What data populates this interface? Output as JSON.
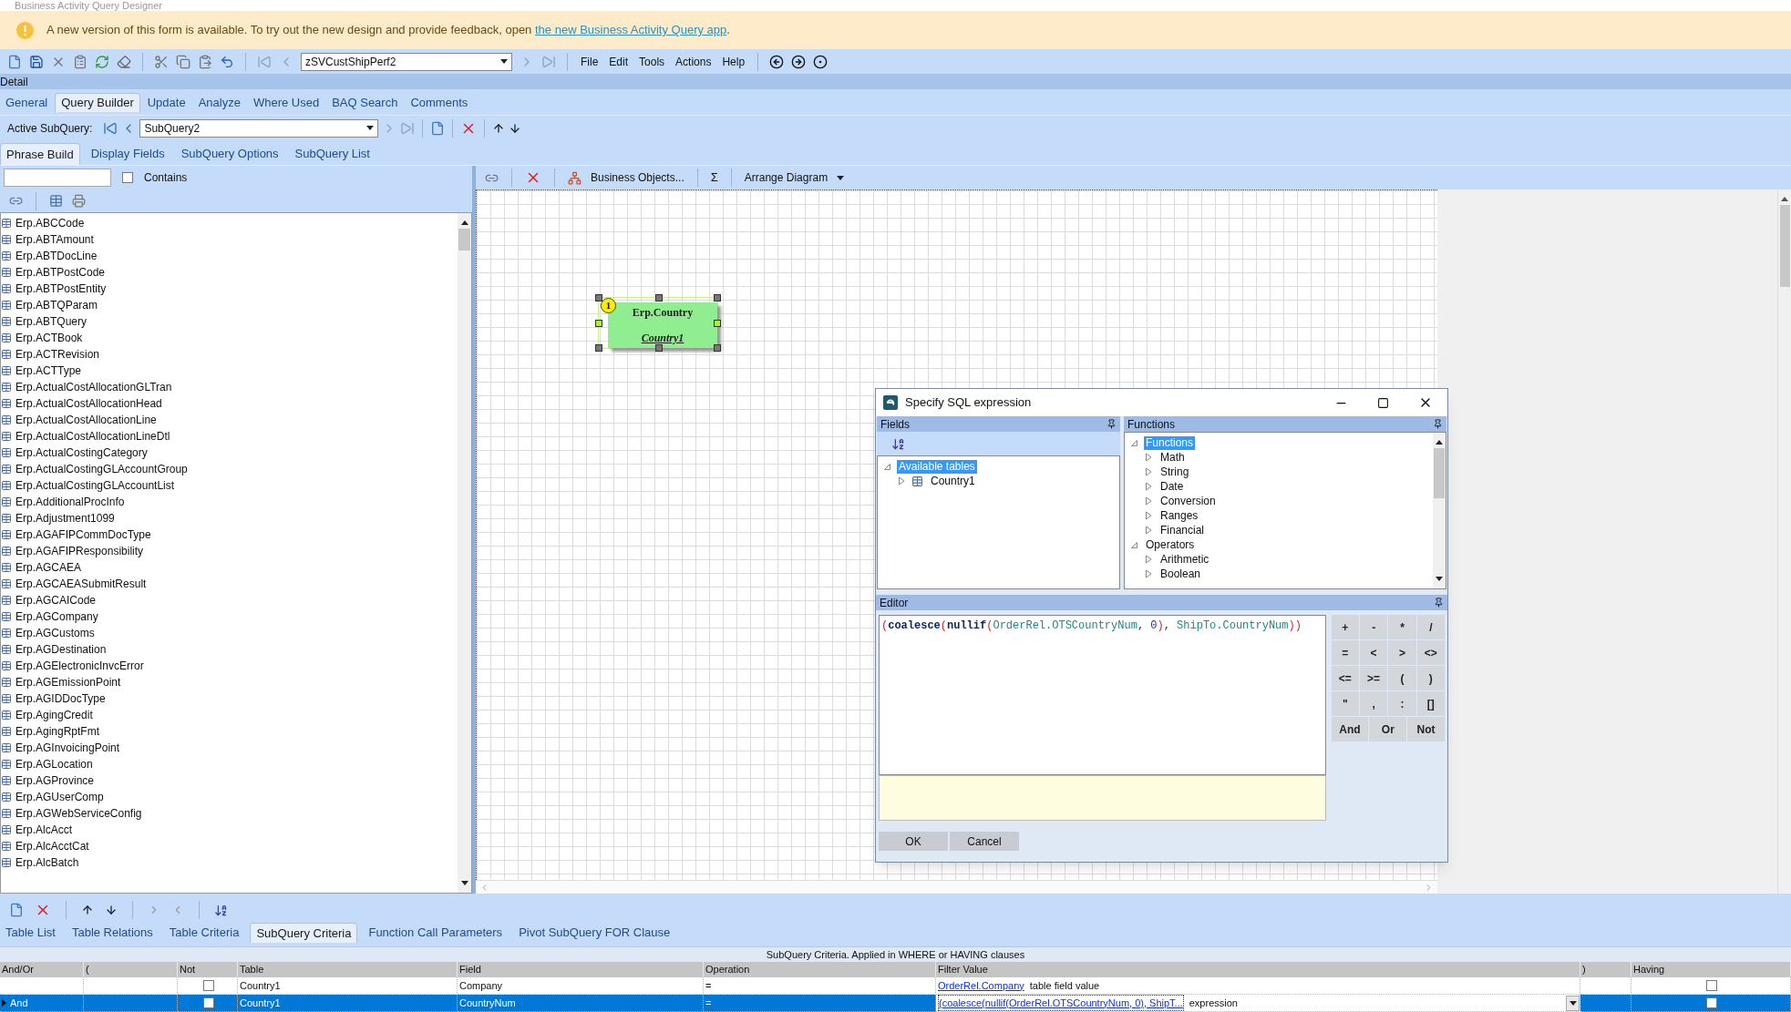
{
  "window": {
    "title": "Business Activity Query Designer"
  },
  "banner": {
    "text": "A new version of this form is available. To try out the new design and provide feedback, open",
    "link": "the new Business Activity Query app",
    "suffix": "."
  },
  "toolbar": {
    "query_id": "zSVCustShipPerf2",
    "menus": [
      "File",
      "Edit",
      "Tools",
      "Actions",
      "Help"
    ]
  },
  "section": "Detail",
  "tabs": [
    {
      "label": "General",
      "selected": false
    },
    {
      "label": "Query Builder",
      "selected": true
    },
    {
      "label": "Update",
      "selected": false
    },
    {
      "label": "Analyze",
      "selected": false
    },
    {
      "label": "Where Used",
      "selected": false
    },
    {
      "label": "BAQ Search",
      "selected": false
    },
    {
      "label": "Comments",
      "selected": false
    }
  ],
  "active_subquery": {
    "label": "Active SubQuery:",
    "value": "SubQuery2"
  },
  "subtabs": [
    {
      "label": "Phrase Build",
      "selected": true
    },
    {
      "label": "Display Fields",
      "selected": false
    },
    {
      "label": "SubQuery Options",
      "selected": false
    },
    {
      "label": "SubQuery List",
      "selected": false
    }
  ],
  "table_search": {
    "contains_label": "Contains",
    "contains_checked": false
  },
  "tables": [
    "Erp.ABCCode",
    "Erp.ABTAmount",
    "Erp.ABTDocLine",
    "Erp.ABTPostCode",
    "Erp.ABTPostEntity",
    "Erp.ABTQParam",
    "Erp.ABTQuery",
    "Erp.ACTBook",
    "Erp.ACTRevision",
    "Erp.ACTType",
    "Erp.ActualCostAllocationGLTran",
    "Erp.ActualCostAllocationHead",
    "Erp.ActualCostAllocationLine",
    "Erp.ActualCostAllocationLineDtl",
    "Erp.ActualCostingCategory",
    "Erp.ActualCostingGLAccountGroup",
    "Erp.ActualCostingGLAccountList",
    "Erp.AdditionalProcInfo",
    "Erp.Adjustment1099",
    "Erp.AGAFIPCommDocType",
    "Erp.AGAFIPResponsibility",
    "Erp.AGCAEA",
    "Erp.AGCAEASubmitResult",
    "Erp.AGCAICode",
    "Erp.AGCompany",
    "Erp.AGCustoms",
    "Erp.AGDestination",
    "Erp.AGElectronicInvcError",
    "Erp.AGEmissionPoint",
    "Erp.AGIDDocType",
    "Erp.AgingCredit",
    "Erp.AgingRptFmt",
    "Erp.AGInvoicingPoint",
    "Erp.AGLocation",
    "Erp.AGProvince",
    "Erp.AGUserComp",
    "Erp.AGWebServiceConfig",
    "Erp.AlcAcct",
    "Erp.AlcAcctCat",
    "Erp.AlcBatch"
  ],
  "diagram_toolbar": {
    "business_objects": "Business Objects...",
    "sigma": "Σ",
    "arrange": "Arrange Diagram"
  },
  "diagram_node": {
    "number": "1",
    "table": "Erp.Country",
    "alias": "Country1",
    "selected": true
  },
  "dialog": {
    "title": "Specify SQL expression",
    "fields_title": "Fields",
    "fields_tree": [
      {
        "label": "Available tables",
        "selected": true,
        "expanded": true,
        "children": [
          {
            "label": "Country1",
            "selected": false,
            "expanded": false,
            "kind": "table"
          }
        ]
      }
    ],
    "functions_title": "Functions",
    "functions_tree": [
      {
        "label": "Functions",
        "selected": true,
        "expanded": true,
        "children": [
          {
            "label": "Math",
            "selected": false,
            "expanded": false
          },
          {
            "label": "String",
            "selected": false,
            "expanded": false
          },
          {
            "label": "Date",
            "selected": false,
            "expanded": false
          },
          {
            "label": "Conversion",
            "selected": false,
            "expanded": false
          },
          {
            "label": "Ranges",
            "selected": false,
            "expanded": false
          },
          {
            "label": "Financial",
            "selected": false,
            "expanded": false
          }
        ]
      },
      {
        "label": "Operators",
        "selected": false,
        "expanded": true,
        "children": [
          {
            "label": "Arithmetic",
            "selected": false,
            "expanded": false
          },
          {
            "label": "Boolean",
            "selected": false,
            "expanded": false
          }
        ]
      }
    ],
    "editor_title": "Editor",
    "expression": [
      {
        "kind": "paren",
        "text": "("
      },
      {
        "kind": "func",
        "text": "coalesce"
      },
      {
        "kind": "paren",
        "text": "("
      },
      {
        "kind": "func",
        "text": "nullif"
      },
      {
        "kind": "paren",
        "text": "("
      },
      {
        "kind": "field",
        "text": "OrderRel.OTSCountryNum"
      },
      {
        "kind": "punct",
        "text": ", "
      },
      {
        "kind": "number",
        "text": "0"
      },
      {
        "kind": "paren",
        "text": ")"
      },
      {
        "kind": "punct",
        "text": ", "
      },
      {
        "kind": "field",
        "text": "ShipTo.CountryNum"
      },
      {
        "kind": "paren",
        "text": ")"
      },
      {
        "kind": "paren",
        "text": ")"
      }
    ],
    "operators": [
      "+",
      "-",
      "*",
      "/",
      "=",
      "<",
      ">",
      "<>",
      "<=",
      ">=",
      "(",
      ")",
      "\"",
      ",",
      ":",
      "[]"
    ],
    "logic": [
      "And",
      "Or",
      "Not"
    ],
    "buttons": [
      "OK",
      "Cancel"
    ]
  },
  "bottom_tabs": [
    {
      "label": "Table List",
      "selected": false
    },
    {
      "label": "Table Relations",
      "selected": false
    },
    {
      "label": "Table Criteria",
      "selected": false
    },
    {
      "label": "SubQuery Criteria",
      "selected": true
    },
    {
      "label": "Function Call Parameters",
      "selected": false
    },
    {
      "label": "Pivot SubQuery FOR Clause",
      "selected": false
    }
  ],
  "criteria": {
    "caption": "SubQuery Criteria. Applied in WHERE or HAVING clauses",
    "columns": [
      "And/Or",
      "(",
      "Not",
      "Table",
      "Field",
      "Operation",
      "Filter Value",
      ")",
      "Having"
    ],
    "rows": [
      {
        "selected": false,
        "not": false,
        "table": "Country1",
        "field": "Company",
        "operation": "=",
        "filter_link": "OrderRel.Company",
        "filter_type": "table field value",
        "having": false
      },
      {
        "selected": true,
        "and_or": "And",
        "not": false,
        "table": "Country1",
        "field": "CountryNum",
        "operation": "=",
        "filter_link": "(coalesce(nullif(OrderRel.OTSCountryNum, 0), ShipT...",
        "filter_type": "expression",
        "having": false
      }
    ]
  }
}
